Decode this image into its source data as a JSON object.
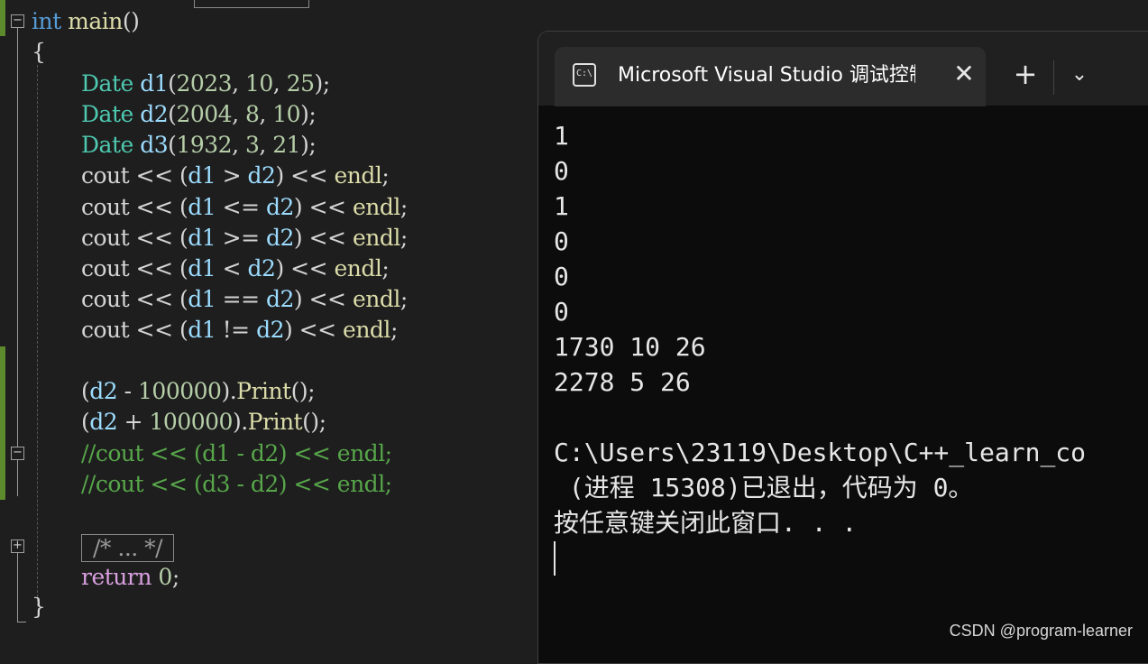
{
  "editor": {
    "collapsed_top_label": "{ ... }",
    "lines": [
      {
        "id": "main",
        "tokens": [
          {
            "t": "int",
            "c": "kw"
          },
          {
            "t": " ",
            "c": "pl"
          },
          {
            "t": "main",
            "c": "fn"
          },
          {
            "t": "()",
            "c": "pl"
          }
        ]
      },
      {
        "id": "open-brace",
        "tokens": [
          {
            "t": "{",
            "c": "pl"
          }
        ]
      },
      {
        "id": "d1",
        "tokens": [
          {
            "t": "Date",
            "c": "tp"
          },
          {
            "t": " ",
            "c": "pl"
          },
          {
            "t": "d1",
            "c": "vr"
          },
          {
            "t": "(",
            "c": "pl"
          },
          {
            "t": "2023",
            "c": "nm"
          },
          {
            "t": ", ",
            "c": "pl"
          },
          {
            "t": "10",
            "c": "nm"
          },
          {
            "t": ", ",
            "c": "pl"
          },
          {
            "t": "25",
            "c": "nm"
          },
          {
            "t": ");",
            "c": "pl"
          }
        ]
      },
      {
        "id": "d2",
        "tokens": [
          {
            "t": "Date",
            "c": "tp"
          },
          {
            "t": " ",
            "c": "pl"
          },
          {
            "t": "d2",
            "c": "vr"
          },
          {
            "t": "(",
            "c": "pl"
          },
          {
            "t": "2004",
            "c": "nm"
          },
          {
            "t": ", ",
            "c": "pl"
          },
          {
            "t": "8",
            "c": "nm"
          },
          {
            "t": ", ",
            "c": "pl"
          },
          {
            "t": "10",
            "c": "nm"
          },
          {
            "t": ");",
            "c": "pl"
          }
        ]
      },
      {
        "id": "d3",
        "tokens": [
          {
            "t": "Date",
            "c": "tp"
          },
          {
            "t": " ",
            "c": "pl"
          },
          {
            "t": "d3",
            "c": "vr"
          },
          {
            "t": "(",
            "c": "pl"
          },
          {
            "t": "1932",
            "c": "nm"
          },
          {
            "t": ", ",
            "c": "pl"
          },
          {
            "t": "3",
            "c": "nm"
          },
          {
            "t": ", ",
            "c": "pl"
          },
          {
            "t": "21",
            "c": "nm"
          },
          {
            "t": ");",
            "c": "pl"
          }
        ]
      },
      {
        "id": "cout-gt",
        "tokens": [
          {
            "t": "cout",
            "c": "pl"
          },
          {
            "t": " << (",
            "c": "pl"
          },
          {
            "t": "d1",
            "c": "vr"
          },
          {
            "t": " > ",
            "c": "pl"
          },
          {
            "t": "d2",
            "c": "vr"
          },
          {
            "t": ") << ",
            "c": "pl"
          },
          {
            "t": "endl",
            "c": "fn"
          },
          {
            "t": ";",
            "c": "pl"
          }
        ]
      },
      {
        "id": "cout-le",
        "tokens": [
          {
            "t": "cout",
            "c": "pl"
          },
          {
            "t": " << (",
            "c": "pl"
          },
          {
            "t": "d1",
            "c": "vr"
          },
          {
            "t": " <= ",
            "c": "pl"
          },
          {
            "t": "d2",
            "c": "vr"
          },
          {
            "t": ") << ",
            "c": "pl"
          },
          {
            "t": "endl",
            "c": "fn"
          },
          {
            "t": ";",
            "c": "pl"
          }
        ]
      },
      {
        "id": "cout-ge",
        "tokens": [
          {
            "t": "cout",
            "c": "pl"
          },
          {
            "t": " << (",
            "c": "pl"
          },
          {
            "t": "d1",
            "c": "vr"
          },
          {
            "t": " >= ",
            "c": "pl"
          },
          {
            "t": "d2",
            "c": "vr"
          },
          {
            "t": ") << ",
            "c": "pl"
          },
          {
            "t": "endl",
            "c": "fn"
          },
          {
            "t": ";",
            "c": "pl"
          }
        ]
      },
      {
        "id": "cout-lt",
        "tokens": [
          {
            "t": "cout",
            "c": "pl"
          },
          {
            "t": " << (",
            "c": "pl"
          },
          {
            "t": "d1",
            "c": "vr"
          },
          {
            "t": " < ",
            "c": "pl"
          },
          {
            "t": "d2",
            "c": "vr"
          },
          {
            "t": ") << ",
            "c": "pl"
          },
          {
            "t": "endl",
            "c": "fn"
          },
          {
            "t": ";",
            "c": "pl"
          }
        ]
      },
      {
        "id": "cout-eq",
        "tokens": [
          {
            "t": "cout",
            "c": "pl"
          },
          {
            "t": " << (",
            "c": "pl"
          },
          {
            "t": "d1",
            "c": "vr"
          },
          {
            "t": " == ",
            "c": "pl"
          },
          {
            "t": "d2",
            "c": "vr"
          },
          {
            "t": ") << ",
            "c": "pl"
          },
          {
            "t": "endl",
            "c": "fn"
          },
          {
            "t": ";",
            "c": "pl"
          }
        ]
      },
      {
        "id": "cout-ne",
        "tokens": [
          {
            "t": "cout",
            "c": "pl"
          },
          {
            "t": " << (",
            "c": "pl"
          },
          {
            "t": "d1",
            "c": "vr"
          },
          {
            "t": " != ",
            "c": "pl"
          },
          {
            "t": "d2",
            "c": "vr"
          },
          {
            "t": ") << ",
            "c": "pl"
          },
          {
            "t": "endl",
            "c": "fn"
          },
          {
            "t": ";",
            "c": "pl"
          }
        ]
      },
      {
        "id": "blank1",
        "tokens": []
      },
      {
        "id": "print-minus",
        "tokens": [
          {
            "t": "(",
            "c": "pl"
          },
          {
            "t": "d2",
            "c": "vr"
          },
          {
            "t": " - ",
            "c": "pl"
          },
          {
            "t": "100000",
            "c": "nm"
          },
          {
            "t": ").",
            "c": "pl"
          },
          {
            "t": "Print",
            "c": "fn"
          },
          {
            "t": "();",
            "c": "pl"
          }
        ]
      },
      {
        "id": "print-plus",
        "tokens": [
          {
            "t": "(",
            "c": "pl"
          },
          {
            "t": "d2",
            "c": "vr"
          },
          {
            "t": " + ",
            "c": "pl"
          },
          {
            "t": "100000",
            "c": "nm"
          },
          {
            "t": ").",
            "c": "pl"
          },
          {
            "t": "Print",
            "c": "fn"
          },
          {
            "t": "();",
            "c": "pl"
          }
        ]
      },
      {
        "id": "comment1",
        "tokens": [
          {
            "t": "//cout << (d1 - d2) << endl;",
            "c": "cm"
          }
        ]
      },
      {
        "id": "comment2",
        "tokens": [
          {
            "t": "//cout << (d3 - d2) << endl;",
            "c": "cm"
          }
        ]
      },
      {
        "id": "blank2",
        "tokens": []
      },
      {
        "id": "collapsed",
        "tokens": [
          {
            "t": "/* ... */",
            "c": "box"
          }
        ]
      },
      {
        "id": "return",
        "tokens": [
          {
            "t": "return",
            "c": "rt"
          },
          {
            "t": " ",
            "c": "pl"
          },
          {
            "t": "0",
            "c": "nm"
          },
          {
            "t": ";",
            "c": "pl"
          }
        ]
      },
      {
        "id": "close-brace",
        "tokens": [
          {
            "t": "}",
            "c": "pl"
          }
        ]
      }
    ]
  },
  "console": {
    "tab_title": "Microsoft Visual Studio 调试控制台",
    "tab_icon_text": "C:\\",
    "close_glyph": "✕",
    "new_tab_glyph": "+",
    "dropdown_glyph": "⌄",
    "output_lines": [
      "1",
      "0",
      "1",
      "0",
      "0",
      "0",
      "1730 10 26",
      "2278 5 26",
      "",
      "C:\\Users\\23119\\Desktop\\C++_learn_co",
      " (进程 15308)已退出，代码为 0。",
      "按任意键关闭此窗口. . ."
    ]
  },
  "watermark": "CSDN @program-learner"
}
